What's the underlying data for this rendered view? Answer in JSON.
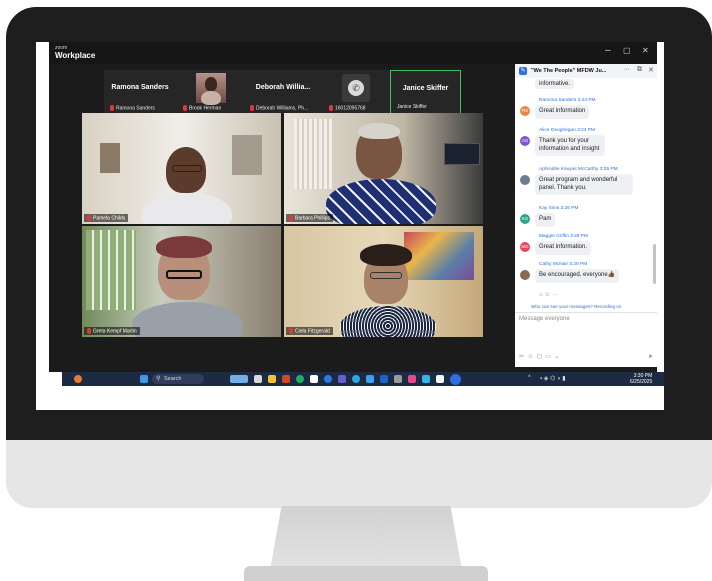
{
  "app": {
    "logo_small": "zoom",
    "logo_big": "Workplace",
    "window_controls": {
      "minimize": "–",
      "maximize": "▢",
      "close": "✕"
    }
  },
  "participant_strip": [
    {
      "name": "Ramona Sanders",
      "label": "Ramona Sanders"
    },
    {
      "name": "",
      "label": "Brook Herman"
    },
    {
      "name": "Deborah  Willia...",
      "label": "Deborah Williams, Ph..."
    },
    {
      "name": "",
      "label": "16012095768"
    },
    {
      "name": "Janice Skiffer",
      "label": "Janice Skiffer"
    }
  ],
  "video_grid": [
    {
      "label": "Pamela Childs"
    },
    {
      "label": "Barbara Phillips"
    },
    {
      "label": "Greta Kempf Martin"
    },
    {
      "label": "Ciela Fitzgerald"
    }
  ],
  "chat": {
    "title": "\"We The People\" MFDW Ju...",
    "header_controls": {
      "more": "···",
      "popout": "⧉",
      "close": "✕"
    },
    "first_line": "informative.",
    "messages": [
      {
        "sender": "Ramona Sanders 3:24 PM",
        "initials": "RS",
        "color": "#e7864a",
        "text": "Great information"
      },
      {
        "sender": "Alice Geoghegan 3:24 PM",
        "initials": "AG",
        "color": "#7b59c9",
        "text": "Thank you for your information and insight"
      },
      {
        "sender": "Aphrodite Kavyas McCarthy 3:25 PM",
        "initials": "",
        "color": "#6b7d92",
        "text": "Great program and wonderful panel. Thank you."
      },
      {
        "sender": "Kay Sims 3:26 PM",
        "initials": "KS",
        "color": "#2ea58a",
        "text": "Pam"
      },
      {
        "sender": "Maggie Griffin 3:28 PM",
        "initials": "MG",
        "color": "#e5485b",
        "text": "Great information."
      },
      {
        "sender": "Cathy McNair 3:29 PM",
        "initials": "",
        "color": "#8a6b4f",
        "text": "Be encouraged, everyone👍🏾"
      }
    ],
    "visibility_note": "Who can see your messages? Recording on",
    "input_placeholder": "Message everyone",
    "toolbar_icons": [
      "format-icon",
      "emoji-icon",
      "file-icon",
      "screenshot-icon",
      "more-icon",
      "send-icon"
    ]
  },
  "taskbar": {
    "search_label": "Search",
    "time": "3:30 PM",
    "date": "6/25/2025",
    "tray": "^"
  },
  "colors": {
    "accent": "#2d6fe0",
    "active_speaker_border": "#3fbf61",
    "taskbar": "#1c2a44"
  }
}
